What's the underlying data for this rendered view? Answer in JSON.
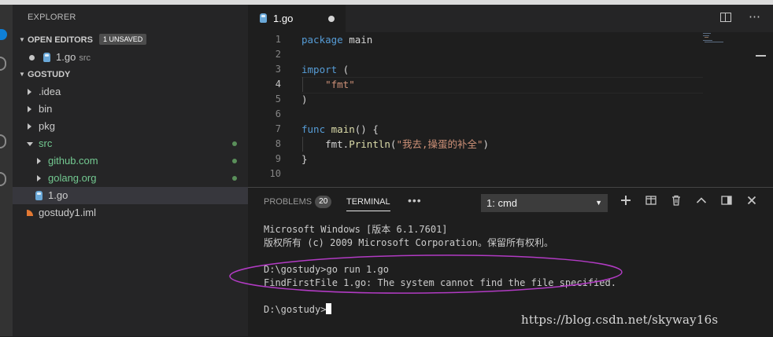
{
  "sidebar": {
    "title": "EXPLORER",
    "open_editors": {
      "label": "OPEN EDITORS",
      "badge": "1 UNSAVED",
      "file": {
        "name": "1.go",
        "folder": "src"
      }
    },
    "workspace": {
      "label": "GOSTUDY",
      "items": [
        {
          "label": ".idea"
        },
        {
          "label": "bin"
        },
        {
          "label": "pkg"
        },
        {
          "label": "src"
        },
        {
          "label": "github.com"
        },
        {
          "label": "golang.org"
        },
        {
          "label": "1.go"
        },
        {
          "label": "gostudy1.iml"
        }
      ]
    }
  },
  "editor": {
    "tab": {
      "label": "1.go"
    },
    "line_numbers": [
      "1",
      "2",
      "3",
      "4",
      "5",
      "6",
      "7",
      "8",
      "9",
      "10"
    ],
    "code": {
      "l1_kw": "package",
      "l1_rest": " main",
      "l3_kw": "import",
      "l3_rest": " (",
      "l4_str": "\"fmt\"",
      "l5": ")",
      "l7_kw": "func",
      "l7_fn": "main",
      "l7_rest": "() {",
      "l8_pre": "fmt.",
      "l8_fn": "Println",
      "l8_open": "(",
      "l8_str": "\"我去,操蛋的补全\"",
      "l8_close": ")",
      "l9": "}"
    }
  },
  "panel": {
    "tabs": {
      "problems": "PROBLEMS",
      "problems_count": "20",
      "terminal": "TERMINAL"
    },
    "terminal_select": "1: cmd",
    "icons": [
      "plus-icon",
      "split-icon",
      "trash-icon",
      "chevron-up-icon",
      "maximize-icon",
      "close-icon"
    ],
    "terminal_lines": [
      "Microsoft Windows [版本 6.1.7601]",
      "版权所有 (c) 2009 Microsoft Corporation。保留所有权利。",
      "D:\\gostudy>go run 1.go",
      "FindFirstFile 1.go: The system cannot find the file specified.",
      "D:\\gostudy>"
    ]
  },
  "watermark": "https://blog.csdn.net/skyway16s",
  "colors": {
    "accent": "#0e7fd6",
    "keyword": "#569cd6",
    "string": "#ce9178",
    "function": "#dcdcaa",
    "git_added": "#73c991",
    "annotation": "#b23bc4"
  }
}
